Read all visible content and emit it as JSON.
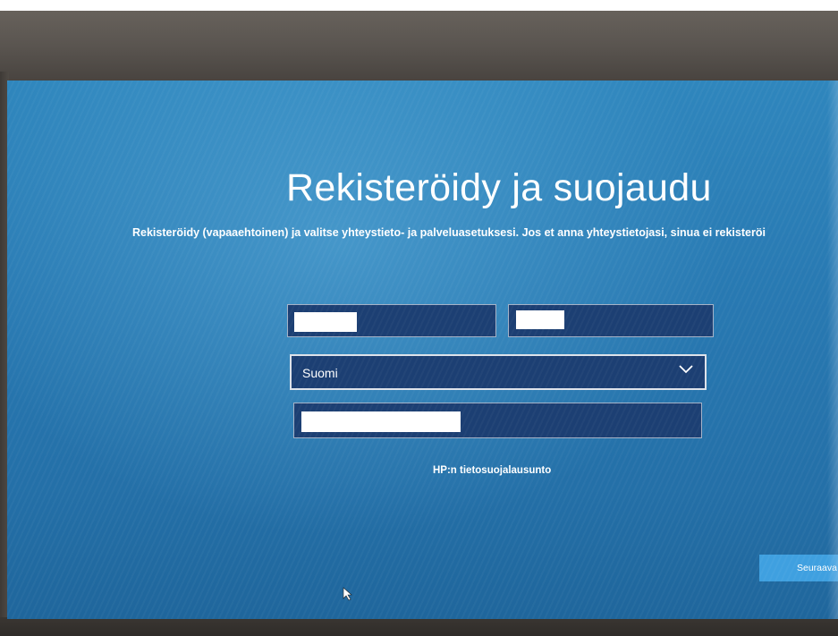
{
  "page": {
    "title": "Rekisteröidy ja suojaudu",
    "subtitle": "Rekisteröidy (vapaaehtoinen) ja valitse yhteystieto- ja palveluasetuksesi. Jos et anna yhteystietojasi, sinua ei rekisteröi"
  },
  "form": {
    "country_value": "Suomi",
    "privacy_link": "HP:n tietosuojalausunto",
    "next_label": "Seuraava"
  },
  "colors": {
    "background": "#2879b2",
    "field": "#1c3f73",
    "button": "#3fa0e0",
    "text": "#ffffff"
  },
  "icons": {
    "dropdown": "chevron-down-icon",
    "pointer": "mouse-cursor-icon"
  }
}
